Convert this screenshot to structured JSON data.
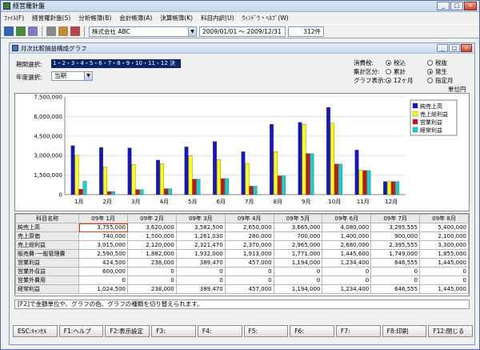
{
  "app": {
    "title": "経営羅針盤"
  },
  "menu": [
    "ﾌｧｲﾙ(F)",
    "経営羅針盤(S)",
    "分析帳簿(B)",
    "会計帳簿(A)",
    "決算帳簿(K)",
    "科目内訳(U)",
    "ｳｨﾝﾄﾞｳ・ﾍﾙﾌﾟ(W)"
  ],
  "toolbar": {
    "company": "株式会社 ABC",
    "period": "2009/01/01 ～ 2009/12/31",
    "count": "312件"
  },
  "window": {
    "title": "月次比較損益構成グラフ"
  },
  "filters": {
    "month_label": "期間選択:",
    "month_range": "1・2・3・4・5・6・7・8・9・10・11・12 決",
    "year_label": "年度選択:",
    "year_value": "当期",
    "tax_label": "消費税:",
    "tax_opt1": "税込",
    "tax_opt2": "税抜",
    "agg_label": "集計区分:",
    "agg_opt1": "累計",
    "agg_opt2": "発生",
    "graph_label": "グラフ表示:",
    "graph_opt1": "12ヶ月",
    "graph_opt2": "指定月",
    "unit": "単位円"
  },
  "colors": {
    "sales": "#1414c8",
    "gross": "#ffff00",
    "operating": "#c81414",
    "ordinary": "#14d2d2"
  },
  "chart_data": {
    "type": "bar",
    "categories": [
      "1月",
      "2月",
      "3月",
      "4月",
      "5月",
      "6月",
      "7月",
      "8月",
      "9月",
      "10月",
      "11月",
      "12月"
    ],
    "ylim": [
      0,
      7500000
    ],
    "yticks": [
      "7,500,000",
      "6,000,000",
      "4,500,000",
      "3,000,000",
      "1,500,000",
      "0"
    ],
    "series": [
      {
        "name": "純売上高",
        "values": [
          3755000,
          3620000,
          3582500,
          2650000,
          3665000,
          4080000,
          3295555,
          5400000,
          5550000,
          6700000,
          3420000,
          1000000
        ]
      },
      {
        "name": "売上総利益",
        "values": [
          3015000,
          2120000,
          2321470,
          2370000,
          2965000,
          2680000,
          2395555,
          3300000,
          5400000,
          5500000,
          1900000,
          1000000
        ]
      },
      {
        "name": "営業利益",
        "values": [
          424500,
          238000,
          389470,
          457000,
          1194000,
          1234400,
          646555,
          1445000,
          3150000,
          2350000,
          1850000,
          1000000
        ]
      },
      {
        "name": "経常利益",
        "values": [
          1024500,
          238000,
          389470,
          457000,
          1194000,
          1234400,
          646555,
          1445000,
          3150000,
          2350000,
          1850000,
          1000000
        ]
      }
    ]
  },
  "table": {
    "corner": "科目名称",
    "headers": [
      "09年 1月",
      "09年 2月",
      "09年 3月",
      "09年 4月",
      "09年 5月",
      "09年 6月",
      "09年 7月",
      "09年 8月"
    ],
    "rows": [
      {
        "name": "純売上高",
        "cells": [
          "3,755,000",
          "3,620,000",
          "3,582,500",
          "2,650,000",
          "3,665,000",
          "4,080,000",
          "3,295,555",
          "5,400,000"
        ]
      },
      {
        "name": "売上原価",
        "cells": [
          "740,000",
          "1,500,000",
          "1,261,030",
          "280,000",
          "700,000",
          "1,400,000",
          "900,000",
          "2,100,000"
        ]
      },
      {
        "name": "売上総利益",
        "cells": [
          "3,015,000",
          "2,120,000",
          "2,321,470",
          "2,370,000",
          "2,965,000",
          "2,680,000",
          "2,395,555",
          "3,300,000"
        ]
      },
      {
        "name": "販売費･一般管理費",
        "cells": [
          "2,590,500",
          "1,882,000",
          "1,932,000",
          "1,913,000",
          "1,771,000",
          "1,445,600",
          "1,749,000",
          "1,855,000"
        ]
      },
      {
        "name": "営業利益",
        "cells": [
          "424,500",
          "238,000",
          "389,470",
          "457,000",
          "1,194,000",
          "1,234,400",
          "646,555",
          "1,445,000"
        ]
      },
      {
        "name": "営業外収益",
        "cells": [
          "600,000",
          "0",
          "0",
          "0",
          "0",
          "0",
          "0",
          "0"
        ]
      },
      {
        "name": "営業外費用",
        "cells": [
          "0",
          "0",
          "0",
          "0",
          "0",
          "0",
          "0",
          "0"
        ]
      },
      {
        "name": "経常利益",
        "cells": [
          "1,024,500",
          "238,000",
          "389,470",
          "457,000",
          "1,194,000",
          "1,234,400",
          "646,555",
          "1,445,000"
        ]
      }
    ]
  },
  "status": "[F2]で金額単位や、グラフの色、グラフの種類を切り替えられます。",
  "fkeys": [
    "ESC:ｷｬﾝｾﾙ",
    "F1:ヘルプ",
    "F2:表示設定",
    "F3:",
    "F4:",
    "F5:",
    "F6:",
    "F7:",
    "F8:印刷",
    "F12:閉じる"
  ]
}
